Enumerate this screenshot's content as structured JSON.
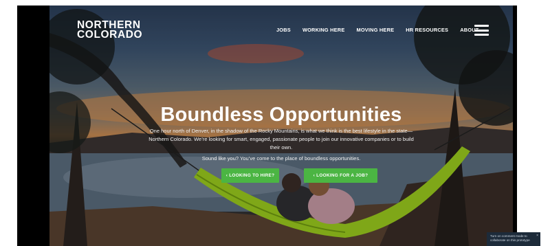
{
  "brand": {
    "line1": "NORTHERN",
    "line2": "COLORADO"
  },
  "nav": {
    "items": [
      {
        "label": "JOBS"
      },
      {
        "label": "WORKING HERE"
      },
      {
        "label": "MOVING HERE"
      },
      {
        "label": "HR RESOURCES"
      },
      {
        "label": "ABOUT"
      }
    ],
    "menu_icon": "hamburger-menu-icon"
  },
  "hero": {
    "title": "Boundless Opportunities",
    "intro": "One hour north of Denver, in the shadow of the Rocky Mountains, is what we think is the best lifestyle in the state—Northern Colorado. We’re looking for smart, engaged, passionate people to join our innovative companies or to build their own.",
    "subtitle": "Sound like you? You’ve come to the place of boundless opportunities.",
    "cta_hire": "‹ LOOKING TO HIRE?",
    "cta_job": "‹ LOOKING FOR A JOB?"
  },
  "toast": {
    "text": "Turn on comment mode to collaborate on this prototype",
    "close": "×"
  },
  "colors": {
    "cta_green": "#4bb543",
    "hammock_green": "#9ccc1e",
    "text_white": "#ffffff",
    "frame_black": "#000000"
  }
}
